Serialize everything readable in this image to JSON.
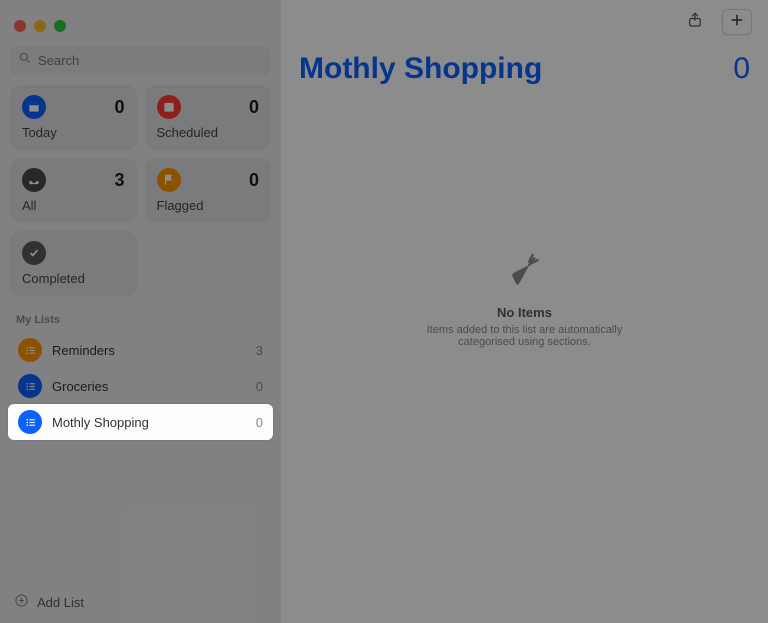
{
  "sidebar": {
    "search_placeholder": "Search",
    "smart_lists": [
      {
        "key": "today",
        "label": "Today",
        "count": 0,
        "color": "#0a61ff"
      },
      {
        "key": "scheduled",
        "label": "Scheduled",
        "count": 0,
        "color": "#ff3b30"
      },
      {
        "key": "all",
        "label": "All",
        "count": 3,
        "color": "#4a4a4c"
      },
      {
        "key": "flagged",
        "label": "Flagged",
        "count": 0,
        "color": "#ff9500"
      },
      {
        "key": "completed",
        "label": "Completed",
        "count": "",
        "color": "#5a5a5e"
      }
    ],
    "section_title": "My Lists",
    "lists": [
      {
        "name": "Reminders",
        "count": 3,
        "color": "#ff9500",
        "selected": false
      },
      {
        "name": "Groceries",
        "count": 0,
        "color": "#0a61ff",
        "selected": false
      },
      {
        "name": "Mothly Shopping",
        "count": 0,
        "color": "#0a61ff",
        "selected": true
      }
    ],
    "add_list_label": "Add List"
  },
  "main": {
    "title": "Mothly Shopping",
    "count": 0,
    "accent": "#0a61ff",
    "empty_title": "No Items",
    "empty_subtitle": "Items added to this list are automatically categorised using sections."
  }
}
